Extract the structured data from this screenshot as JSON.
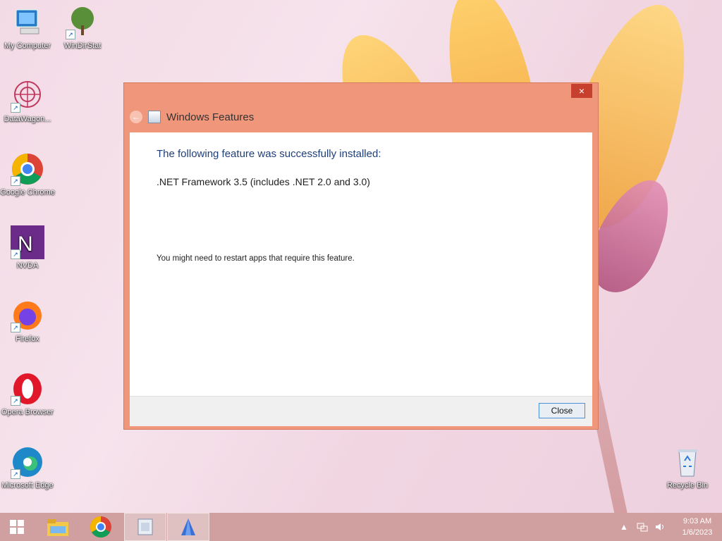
{
  "desktop": {
    "icons": [
      {
        "label": "My Computer"
      },
      {
        "label": "WinDirStat"
      },
      {
        "label": "DataWagon..."
      },
      {
        "label": "Google Chrome"
      },
      {
        "label": "NVDA"
      },
      {
        "label": "Firefox"
      },
      {
        "label": "Opera Browser"
      },
      {
        "label": "Microsoft Edge"
      },
      {
        "label": "Recycle Bin"
      }
    ]
  },
  "dialog": {
    "title": "Windows Features",
    "close_glyph": "×",
    "headline": "The following feature was successfully installed:",
    "feature": ".NET Framework 3.5 (includes .NET 2.0 and 3.0)",
    "note": "You might need to restart apps that require this feature.",
    "close_button": "Close"
  },
  "taskbar": {
    "time": "9:03 AM",
    "date": "1/6/2023"
  }
}
